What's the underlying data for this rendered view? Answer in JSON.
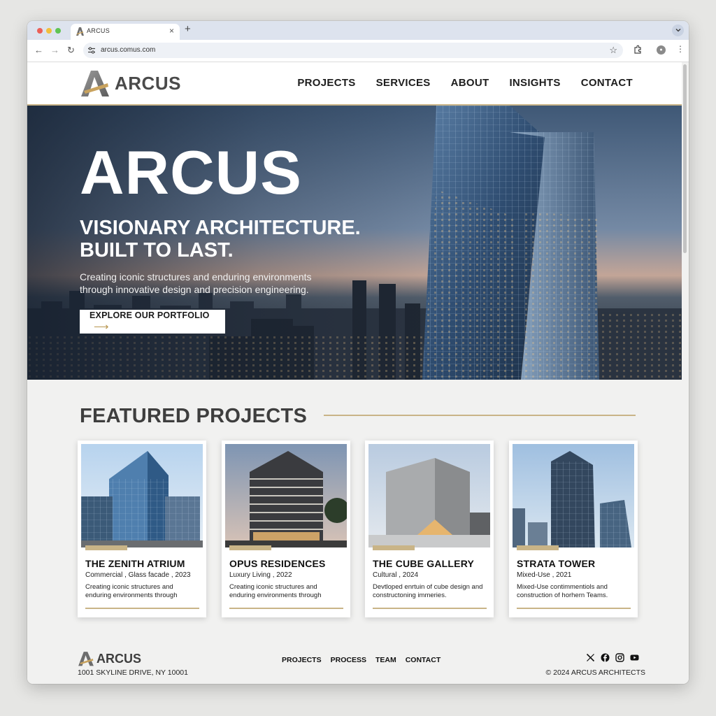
{
  "browser": {
    "tab_title": "ARCUS",
    "tab_close": "×",
    "new_tab": "+",
    "url": "arcus.comus.com",
    "nav_back": "←",
    "nav_forward": "→",
    "nav_reload": "↻",
    "star": "☆",
    "menu": "⋮"
  },
  "site": {
    "logo_text": "ARCUS",
    "nav": [
      "PROJECTS",
      "SERVICES",
      "ABOUT",
      "INSIGHTS",
      "CONTACT"
    ]
  },
  "hero": {
    "title": "ARCUS",
    "tagline_line1": "VISIONARY ARCHITECTURE.",
    "tagline_line2": "BUILT TO LAST.",
    "subtitle_line1": "Creating iconic structures and enduring environments",
    "subtitle_line2": "through innovative design and precision engineering.",
    "cta_label": "EXPLORE OUR PORTFOLIO",
    "cta_arrow": "⟶"
  },
  "featured": {
    "title": "FEATURED PROJECTS",
    "projects": [
      {
        "title": "THE ZENITH ATRIUM",
        "meta": "Commercial , Glass facade , 2023",
        "desc": "Creating iconic structures and enduring environments through"
      },
      {
        "title": "OPUS RESIDENCES",
        "meta": "Luxury Living , 2022",
        "desc": "Creating iconic structures and enduring environments through"
      },
      {
        "title": "THE CUBE GALLERY",
        "meta": "Cultural , 2024",
        "desc": "Devtloped enrtuin of cube design and constructoning immeries."
      },
      {
        "title": "STRATA TOWER",
        "meta": "Mixed-Use , 2021",
        "desc": "Mixed-Use contimmentiols and construction of horhern Teams."
      }
    ]
  },
  "footer": {
    "logo_text": "ARCUS",
    "address": "1001 SKYLINE DRIVE, NY 10001",
    "nav": [
      "PROJECTS",
      "PROCESS",
      "TEAM",
      "CONTACT"
    ],
    "social_icons": [
      "x-icon",
      "facebook-icon",
      "instagram-icon",
      "youtube-icon"
    ],
    "copyright": "© 2024 ARCUS ARCHITECTS"
  },
  "colors": {
    "accent_gold": "#c9b487",
    "text_dark": "#1d1d1d",
    "heading_gray": "#3e3e3e"
  }
}
